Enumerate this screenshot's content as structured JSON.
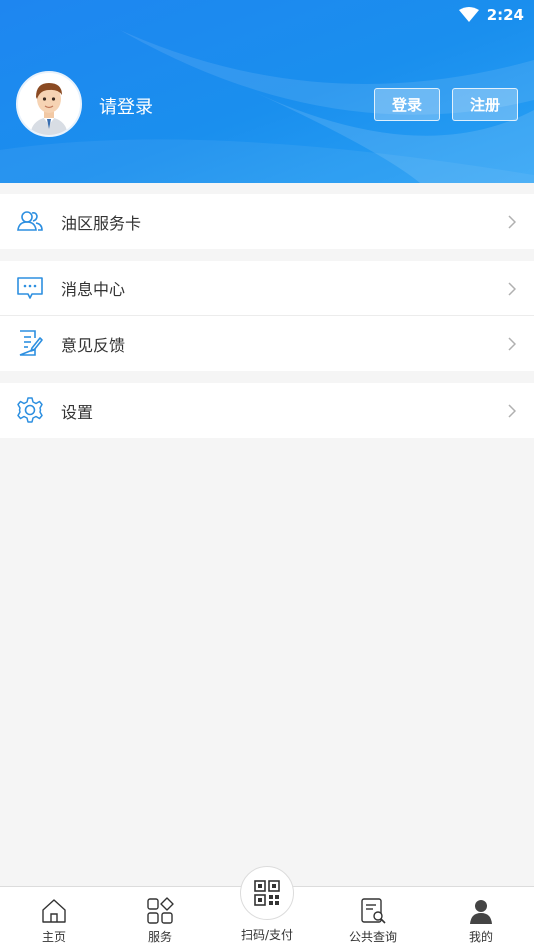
{
  "status_bar": {
    "time": "2:24",
    "wifi_icon": "wifi-icon"
  },
  "header": {
    "login_hint": "请登录",
    "login_button": "登录",
    "register_button": "注册",
    "avatar_icon": "avatar"
  },
  "menu": {
    "group1": [
      {
        "label": "油区服务卡",
        "icon": "people-icon"
      }
    ],
    "group2": [
      {
        "label": "消息中心",
        "icon": "message-icon"
      },
      {
        "label": "意见反馈",
        "icon": "feedback-icon"
      }
    ],
    "group3": [
      {
        "label": "设置",
        "icon": "gear-icon"
      }
    ]
  },
  "tabbar": {
    "home": "主页",
    "service": "服务",
    "scan": "扫码/支付",
    "query": "公共查询",
    "mine": "我的"
  },
  "colors": {
    "accent": "#1a8fee",
    "icon_blue": "#2d8fe0",
    "background": "#f5f5f5"
  }
}
